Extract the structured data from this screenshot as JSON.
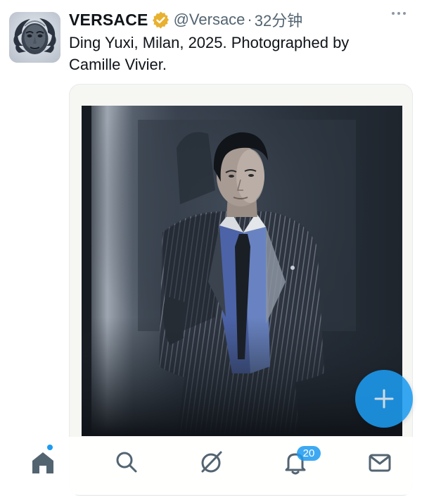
{
  "tweet": {
    "author_name": "VERSACE",
    "handle": "@Versace",
    "separator": "·",
    "time": "32分钟",
    "text": "Ding Yuxi, Milan, 2025. Photographed by Camille Vivier."
  },
  "colors": {
    "accent": "#1d9bf0",
    "verified_gold": "#e8b130",
    "muted_text": "#536471"
  },
  "icons": {
    "verified": "verified-badge-icon",
    "more": "more-options-icon",
    "compose": "compose-plus-icon",
    "home": "home-icon",
    "search": "search-icon",
    "grok": "grok-icon",
    "notifications": "bell-icon",
    "messages": "mail-icon"
  },
  "nav": {
    "notifications_count": "20"
  }
}
